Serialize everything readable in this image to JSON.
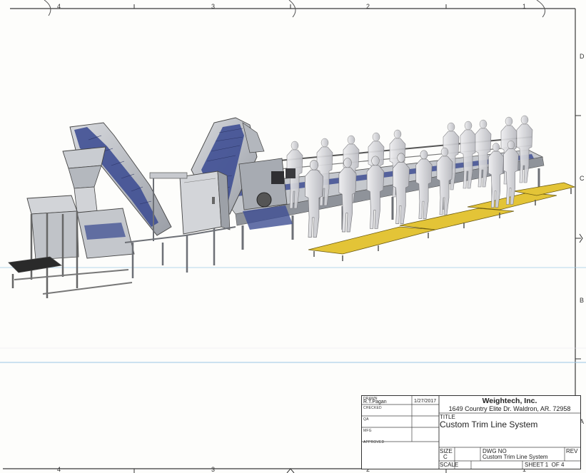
{
  "border": {
    "top_zones": [
      "4",
      "3",
      "2",
      "1"
    ],
    "bottom_zones": [
      "4",
      "3",
      "2",
      "1"
    ],
    "right_zones": [
      "D",
      "C",
      "B",
      "A"
    ]
  },
  "title_block": {
    "rows": [
      {
        "label": "DRAWN",
        "name": "R.T.Pagan",
        "date": "1/27/2017"
      },
      {
        "label": "CHECKED",
        "name": "",
        "date": ""
      },
      {
        "label": "QA",
        "name": "",
        "date": ""
      },
      {
        "label": "MFG",
        "name": "",
        "date": ""
      },
      {
        "label": "APPROVED",
        "name": "",
        "date": ""
      }
    ],
    "company": "Weightech, Inc.",
    "address": "1649 Country Elite Dr. Waldron, AR. 72958",
    "title_label": "TITLE",
    "title": "Custom Trim Line System",
    "size_label": "SIZE",
    "size": "C",
    "dwg_no_label": "DWG NO",
    "dwg_no": "Custom Trim Line System",
    "rev_label": "REV",
    "rev": "",
    "scale_label": "SCALE",
    "scale": "",
    "sheet_label": "SHEET 1  OF 4"
  },
  "colors": {
    "steel": "#b9bcc2",
    "steel_dark": "#7d8188",
    "belt_blue": "#3f4f93",
    "mannequin": "#d6d6d9",
    "yellow_platform": "#e3c437",
    "line": "#3a3a3a",
    "guide_blue": "#9cc8e6"
  }
}
